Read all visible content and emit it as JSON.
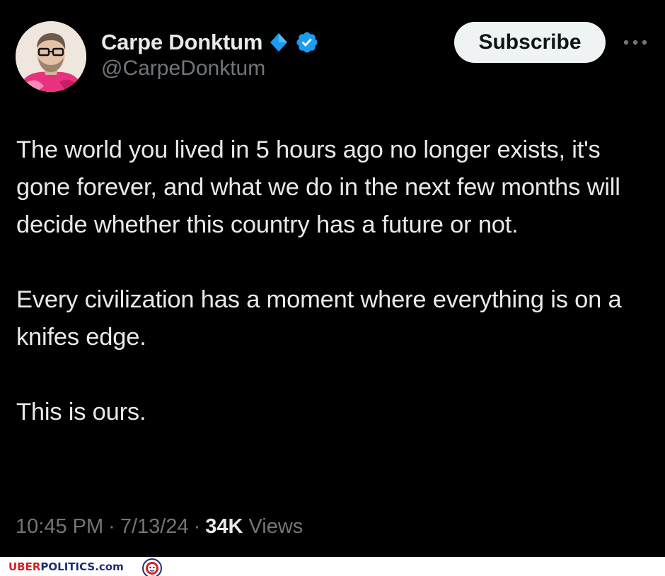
{
  "author": {
    "display_name": "Carpe Donktum",
    "handle": "@CarpeDonktum",
    "avatar_icon": "avatar-photo",
    "badges": [
      "diamond-badge-icon",
      "verified-badge-icon"
    ]
  },
  "actions": {
    "subscribe_label": "Subscribe",
    "more_icon": "more-options-icon"
  },
  "post": {
    "paragraphs": [
      "The world you lived in 5 hours ago no longer exists, it's gone forever, and what we do in the next few months will decide whether this country has a future or not.",
      "Every civilization has a moment where everything is on a knifes edge.",
      "This is ours."
    ],
    "time": "10:45 PM",
    "date": "7/13/24",
    "views_count": "34K",
    "views_label": "Views",
    "separator": "·"
  },
  "watermark": {
    "part1": "UBER",
    "part2": "POLITICS",
    "part3": ".com"
  },
  "colors": {
    "background": "#000000",
    "text_primary": "#e7e9ea",
    "text_secondary": "#71767b",
    "verified_blue": "#1d9bf0",
    "button_bg": "#eff3f4",
    "button_text": "#0f1419"
  }
}
